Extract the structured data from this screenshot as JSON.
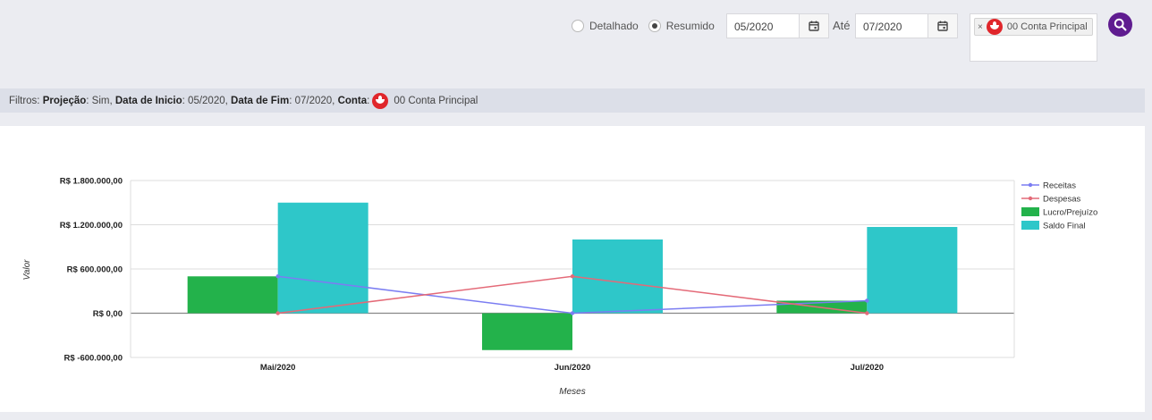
{
  "filters_form": {
    "options": [
      {
        "label": "Detalhado",
        "selected": false
      },
      {
        "label": "Resumido",
        "selected": true
      }
    ],
    "date_from": "05/2020",
    "to_label": "Até",
    "date_to": "07/2020",
    "account_tag": "00 Conta Principal",
    "account_remove": "×"
  },
  "filter_summary": {
    "prefix": "Filtros:",
    "projection_key": "Projeção",
    "projection_val": ": Sim,",
    "start_key": "Data de Inicio",
    "start_val": ": 05/2020,",
    "end_key": "Data de Fim",
    "end_val": ": 07/2020,",
    "account_key": "Conta",
    "account_val": ":",
    "account_name": "00 Conta Principal"
  },
  "colors": {
    "receitas": "#7b7df2",
    "despesas": "#e46a78",
    "lucro": "#23b24b",
    "saldo": "#2ec7c9",
    "search": "#5f1c90"
  },
  "chart_data": {
    "type": "bar",
    "categories": [
      "Mai/2020",
      "Jun/2020",
      "Jul/2020"
    ],
    "xlabel": "Meses",
    "ylabel": "Valor",
    "ylim": [
      -600000,
      1800000
    ],
    "yticks": [
      -600000,
      0,
      600000,
      1200000,
      1800000
    ],
    "ytick_labels": [
      "R$ -600.000,00",
      "R$ 0,00",
      "R$ 600.000,00",
      "R$ 1.200.000,00",
      "R$ 1.800.000,00"
    ],
    "legend_position": "right",
    "series": [
      {
        "name": "Receitas",
        "kind": "line",
        "values": [
          500000,
          0,
          170000
        ]
      },
      {
        "name": "Despesas",
        "kind": "line",
        "values": [
          0,
          500000,
          0
        ]
      },
      {
        "name": "Lucro/Prejuízo",
        "kind": "bar",
        "values": [
          500000,
          -500000,
          170000
        ]
      },
      {
        "name": "Saldo Final",
        "kind": "bar",
        "values": [
          1500000,
          1000000,
          1170000
        ]
      }
    ]
  }
}
